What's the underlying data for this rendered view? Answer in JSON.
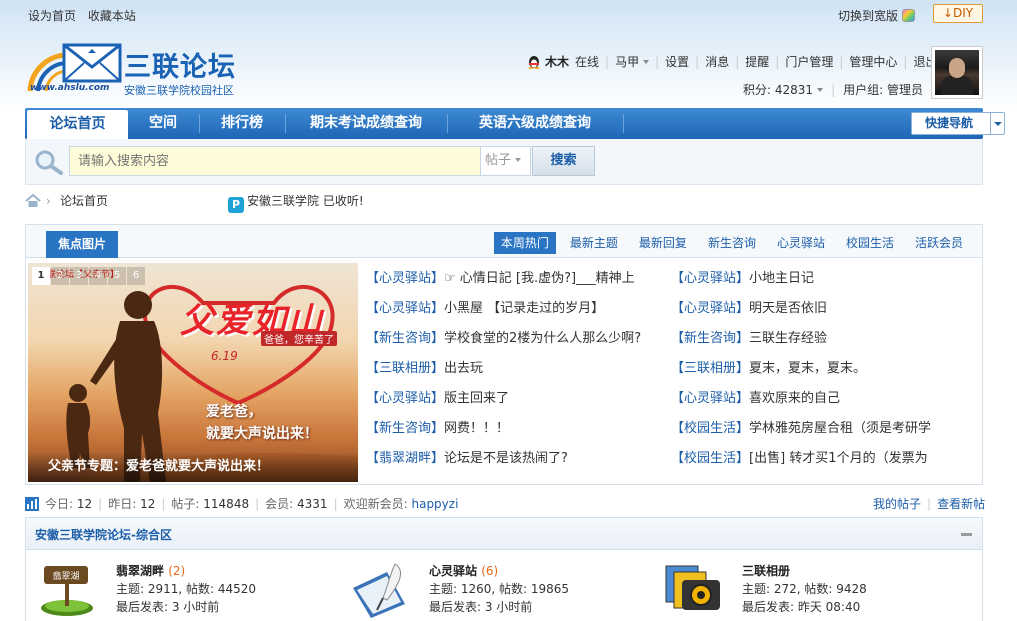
{
  "topbar": {
    "set_home": "设为首页",
    "bookmark": "收藏本站",
    "switch_wide": "切换到宽版",
    "diy": "DIY"
  },
  "logo": {
    "title": "三联论坛",
    "subtitle": "安徽三联学院校园社区",
    "url": "www.ahslu.com"
  },
  "user": {
    "name": "木木",
    "status": "在线",
    "horse": "马甲",
    "links": [
      "设置",
      "消息",
      "提醒",
      "门户管理",
      "管理中心",
      "退出"
    ],
    "points_label": "积分:",
    "points": "42831",
    "group_label": "用户组:",
    "group": "管理员"
  },
  "nav": {
    "items": [
      "论坛首页",
      "空间",
      "排行榜",
      "期末考试成绩查询",
      "英语六级成绩查询"
    ],
    "quick": "快捷导航"
  },
  "search": {
    "placeholder": "请输入搜索内容",
    "scope": "帖子",
    "button": "搜索"
  },
  "breadcrumb": {
    "current": "论坛首页"
  },
  "notice": {
    "text": "安徽三联学院 已收听!"
  },
  "focus": {
    "tab": "焦点图片",
    "hot_tabs": [
      "本周热门",
      "最新主题",
      "最新回复",
      "新生咨询",
      "心灵驿站",
      "校园生活",
      "活跃会员"
    ],
    "slide": {
      "numbers": [
        "1",
        "2",
        "3",
        "4",
        "5",
        "6"
      ],
      "banner_tag": "三联论坛【父亲节】",
      "title": "父爱如山",
      "subtitle": "爸爸，您辛苦了",
      "date": "6.19",
      "message_line1": "爱老爸，",
      "message_line2": "就要大声说出来！",
      "caption": "父亲节专题：爱老爸就要大声说出来！"
    },
    "threads_left": [
      {
        "cat": "【心灵驿站】",
        "title": "☞ 心情日記 [我.虚伪?]___精神上"
      },
      {
        "cat": "【心灵驿站】",
        "title": "小黑屋 【记录走过的岁月】"
      },
      {
        "cat": "【新生咨询】",
        "title": "学校食堂的2楼为什么人那么少啊?"
      },
      {
        "cat": "【三联相册】",
        "title": "出去玩"
      },
      {
        "cat": "【心灵驿站】",
        "title": "版主回来了"
      },
      {
        "cat": "【新生咨询】",
        "title": "网费！！！"
      },
      {
        "cat": "【翡翠湖畔】",
        "title": "论坛是不是该热闹了?"
      }
    ],
    "threads_right": [
      {
        "cat": "【心灵驿站】",
        "title": "小地主日记"
      },
      {
        "cat": "【心灵驿站】",
        "title": "明天是否依旧"
      },
      {
        "cat": "【新生咨询】",
        "title": "三联生存经验"
      },
      {
        "cat": "【三联相册】",
        "title": "夏末，夏末，夏末。"
      },
      {
        "cat": "【心灵驿站】",
        "title": "喜欢原来的自己"
      },
      {
        "cat": "【校园生活】",
        "title": "学林雅苑房屋合租（须是考研学"
      },
      {
        "cat": "【校园生活】",
        "title": "[出售] 转才买1个月的（发票为"
      }
    ]
  },
  "stats": {
    "today_label": "今日:",
    "today": "12",
    "yesterday_label": "昨日:",
    "yesterday": "12",
    "posts_label": "帖子:",
    "posts": "114848",
    "members_label": "会员:",
    "members": "4331",
    "welcome_label": "欢迎新会员:",
    "newest": "happyzi",
    "my_posts": "我的帖子",
    "view_new": "查看新帖"
  },
  "category": {
    "title": "安徽三联学院论坛-综合区",
    "forums": [
      {
        "name": "翡翠湖畔",
        "count": "(2)",
        "stats": "主题: 2911, 帖数: 44520",
        "last": "最后发表: 3 小时前",
        "icon": "lake-icon",
        "sign": "翡翠湖"
      },
      {
        "name": "心灵驿站",
        "count": "(6)",
        "stats": "主题: 1260, 帖数: 19865",
        "last": "最后发表: 3 小时前",
        "icon": "quill-icon"
      },
      {
        "name": "三联相册",
        "count": "",
        "stats": "主题: 272, 帖数: 9428",
        "last": "最后发表: 昨天 08:40",
        "icon": "camera-icon"
      }
    ]
  },
  "colors": {
    "brand": "#1c66b5",
    "link": "#1c5ea8",
    "accent": "#e66a1c"
  }
}
